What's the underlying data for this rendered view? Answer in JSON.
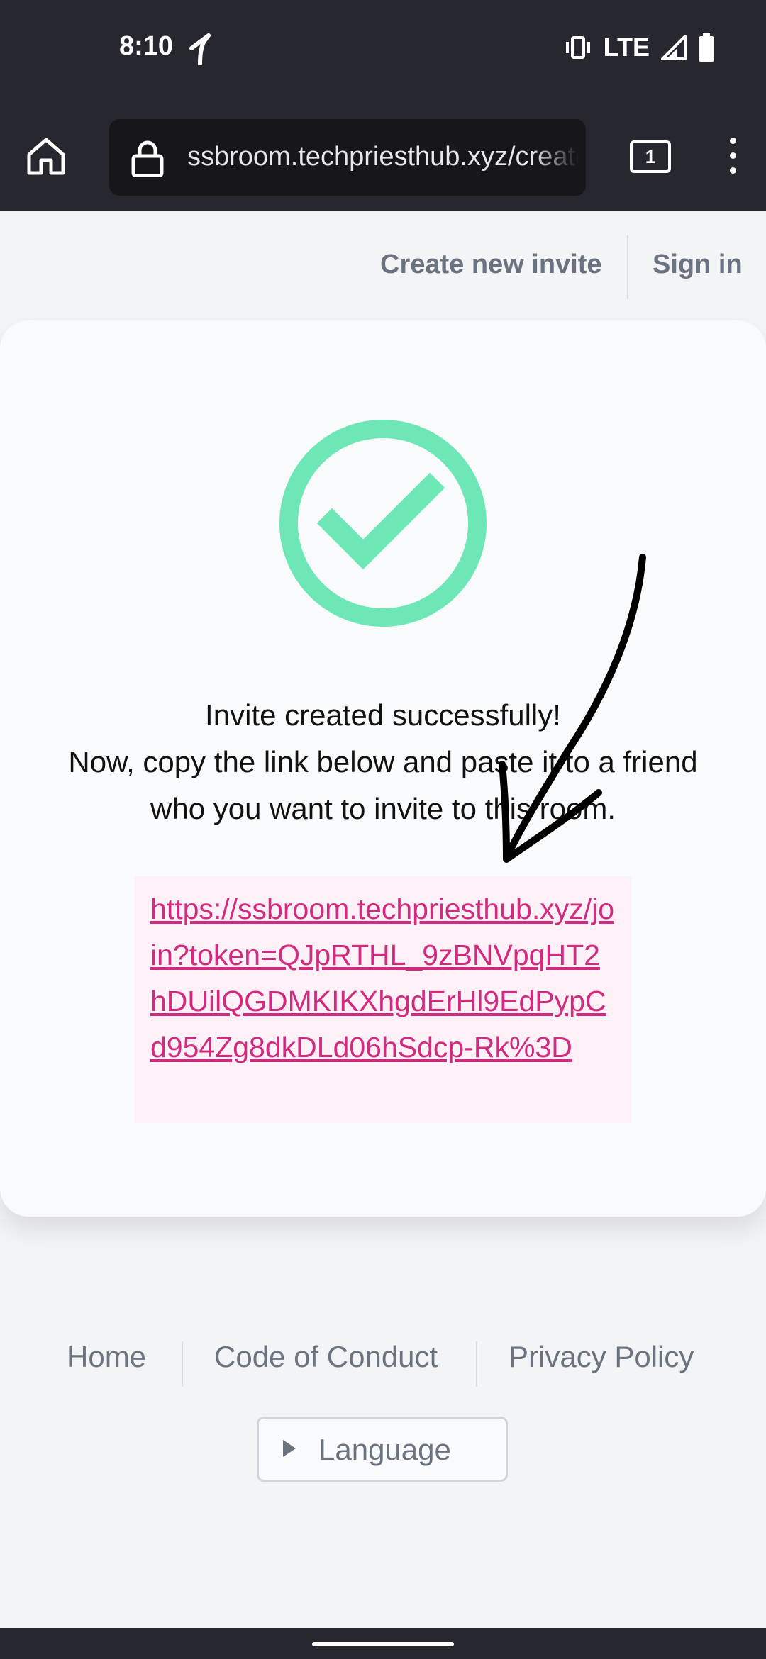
{
  "status_bar": {
    "time": "8:10",
    "network": "LTE"
  },
  "browser": {
    "url": "ssbroom.techpriesthub.xyz/create-invite",
    "tab_count": "1"
  },
  "top_nav": {
    "create_invite": "Create new invite",
    "sign_in": "Sign in"
  },
  "main": {
    "message_line1": "Invite created successfully!",
    "message_line2": "Now, copy the link below and paste it to a friend who you want to invite to this room.",
    "invite_link": "https://ssbroom.techpriesthub.xyz/join?token=QJpRTHL_9zBNVpqHT2hDUilQGDMKIKXhgdErHl9EdPypCd954Zg8dkDLd06hSdcp-Rk%3D"
  },
  "footer": {
    "home": "Home",
    "code_of_conduct": "Code of Conduct",
    "privacy_policy": "Privacy Policy",
    "language": "Language"
  },
  "colors": {
    "success": "#6ee7b7",
    "link": "#d12a7e",
    "link_bg": "#fdf0f6",
    "chrome": "#27272f"
  }
}
